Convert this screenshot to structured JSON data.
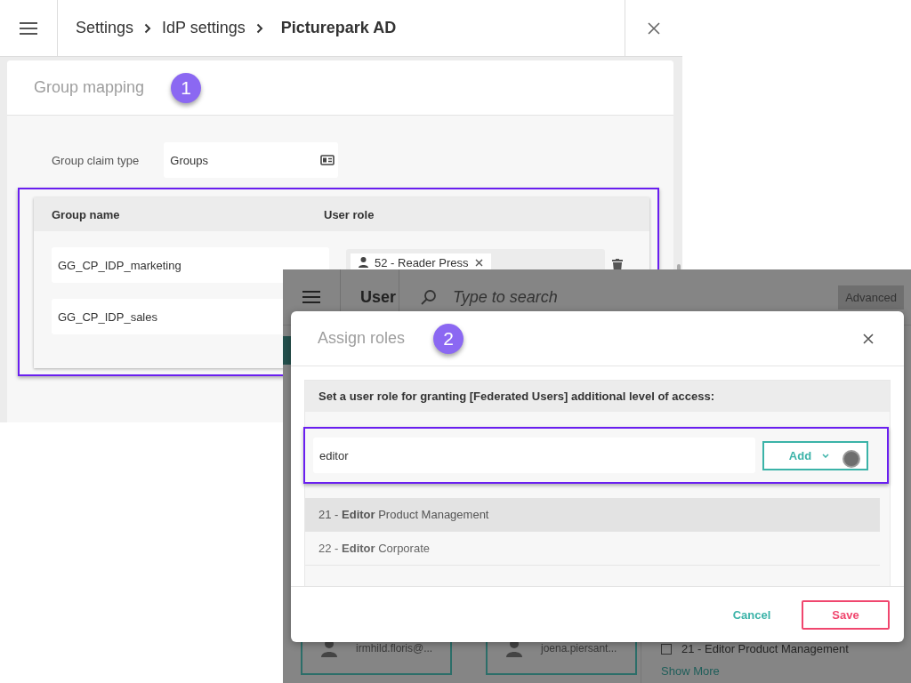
{
  "settings_window": {
    "breadcrumbs": [
      {
        "label": "Settings",
        "current": false
      },
      {
        "label": "IdP settings",
        "current": false
      },
      {
        "label": "Picturepark AD",
        "current": true
      }
    ],
    "section_title": "Group mapping",
    "step_marker": "1",
    "claim_type": {
      "label": "Group claim type",
      "value": "Groups"
    },
    "table": {
      "columns": [
        "Group name",
        "User role"
      ],
      "rows": [
        {
          "group_name": "GG_CP_IDP_marketing",
          "roles": [
            "52 - Reader Press"
          ]
        },
        {
          "group_name": "GG_CP_IDP_sales",
          "roles": []
        }
      ]
    }
  },
  "users_window": {
    "title": "User",
    "search_placeholder": "Type to search",
    "advanced_button": "Advanced",
    "cards": [
      {
        "email": "irmhild.floris@..."
      },
      {
        "email": "joena.piersant..."
      }
    ],
    "filter": {
      "label": "21 - Editor Product Management",
      "checked": false
    },
    "show_more": "Show More"
  },
  "dialog": {
    "title": "Assign roles",
    "step_marker": "2",
    "instruction": "Set a user role for granting [Federated Users] additional level of access:",
    "search_value": "editor",
    "add_button": "Add",
    "results": [
      {
        "text": "21 - **Editor** Product Management",
        "selected": true
      },
      {
        "text": "22 - **Editor** Corporate",
        "selected": false
      }
    ],
    "cancel_button": "Cancel",
    "save_button": "Save"
  }
}
